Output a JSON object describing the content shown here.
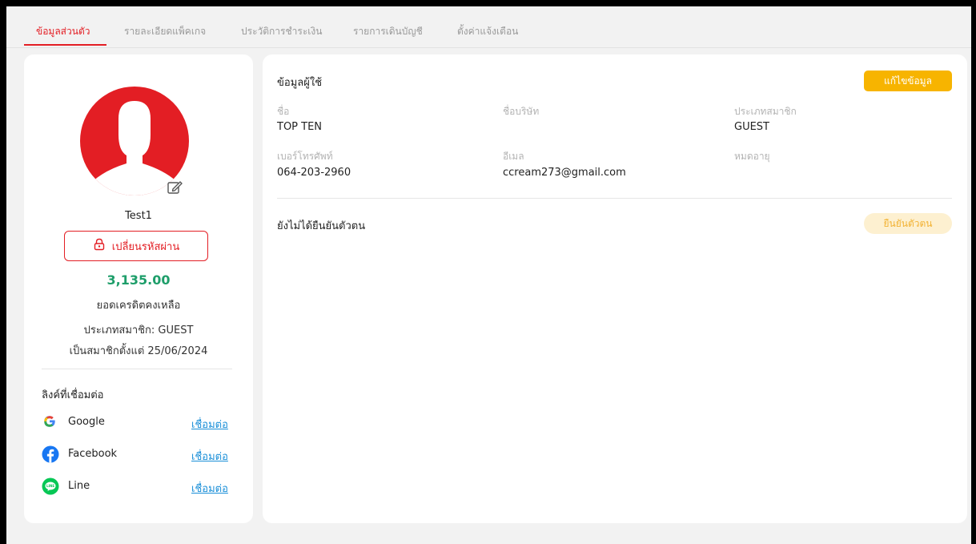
{
  "tabs": [
    {
      "label": "ข้อมูลส่วนตัว",
      "active": true
    },
    {
      "label": "รายละเอียดแพ็คเกจ",
      "active": false
    },
    {
      "label": "ประวัติการชำระเงิน",
      "active": false
    },
    {
      "label": "รายการเดินบัญชี",
      "active": false
    },
    {
      "label": "ตั้งค่าแจ้งเตือน",
      "active": false
    }
  ],
  "profile": {
    "username": "Test1",
    "change_password_label": "เปลี่ยนรหัสผ่าน",
    "balance": "3,135.00",
    "balance_label": "ยอดเครดิตคงเหลือ",
    "member_type": "ประเภทสมาชิก: GUEST",
    "member_since": "เป็นสมาชิกตั้งแต่ 25/06/2024"
  },
  "linked": {
    "title": "ลิงค์ที่เชื่อมต่อ",
    "items": [
      {
        "name": "Google",
        "icon": "google-icon",
        "action": "เชื่อมต่อ"
      },
      {
        "name": "Facebook",
        "icon": "facebook-icon",
        "action": "เชื่อมต่อ"
      },
      {
        "name": "Line",
        "icon": "line-icon",
        "action": "เชื่อมต่อ"
      }
    ]
  },
  "user_info": {
    "title": "ข้อมูลผู้ใช้",
    "edit_label": "แก้ไขข้อมูล",
    "fields": {
      "name": {
        "label": "ชื่อ",
        "value": "TOP TEN"
      },
      "company": {
        "label": "ชื่อบริษัท",
        "value": ""
      },
      "member_type": {
        "label": "ประเภทสมาชิก",
        "value": "GUEST"
      },
      "phone": {
        "label": "เบอร์โทรศัพท์",
        "value": "064-203-2960"
      },
      "email": {
        "label": "อีเมล",
        "value": "ccream273@gmail.com"
      },
      "expiry": {
        "label": "หมดอายุ",
        "value": ""
      }
    },
    "verify_status": "ยังไม่ได้ยืนยันตัวตน",
    "verify_label": "ยืนยันตัวตน"
  },
  "colors": {
    "accent": "#e31e24",
    "balance": "#1e9e6a",
    "edit_button": "#f7b400",
    "link": "#1a8fd8"
  }
}
